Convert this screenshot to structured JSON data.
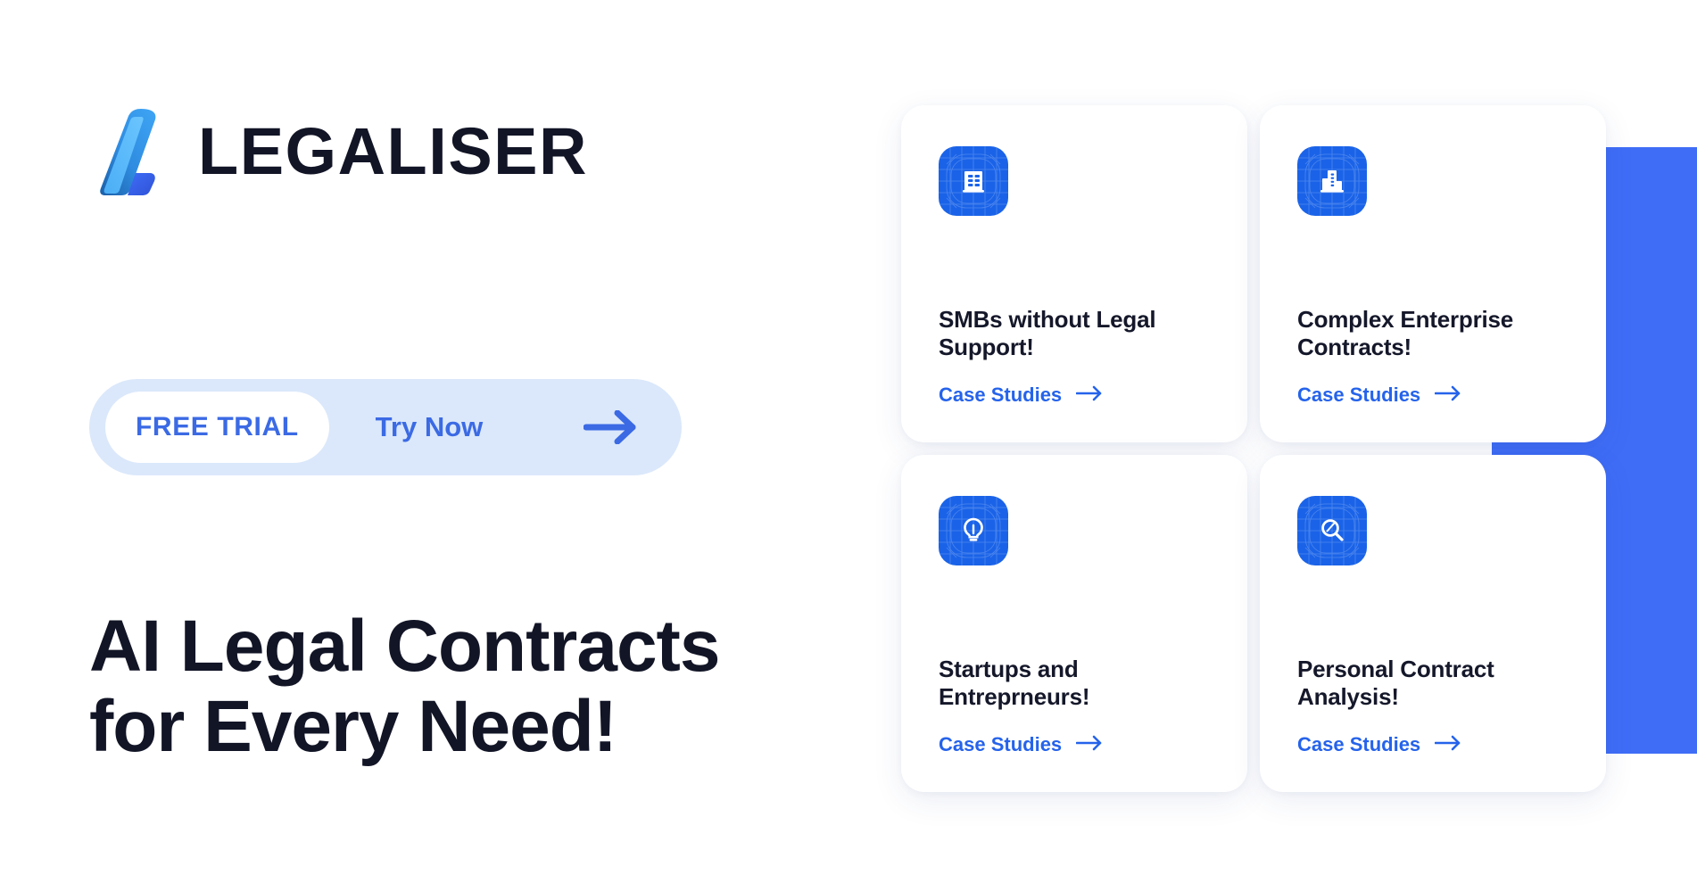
{
  "brand": {
    "name": "LEGALISER",
    "logo_icon": "legaliser-swoosh-logo",
    "colors": {
      "ink": "#121526",
      "accent_blue": "#2563eb",
      "royal_blue": "#3f6df6",
      "icon_tile_blue": "#1a63e8",
      "pill_background": "#dbe8fb",
      "card_background": "#ffffff",
      "page_background": "#ffffff"
    }
  },
  "hero": {
    "headline_line1": "AI Legal Contracts",
    "headline_line2": "for Every Need!",
    "trial": {
      "badge_label": "FREE TRIAL",
      "cta_label": "Try Now",
      "arrow_icon": "arrow-right-icon"
    }
  },
  "cards": [
    {
      "icon": "apartment-building-icon",
      "title": "SMBs without Legal Support!",
      "link_label": "Case Studies",
      "link_arrow_icon": "arrow-right-icon"
    },
    {
      "icon": "enterprise-skyscraper-icon",
      "title": "Complex Enterprise Contracts!",
      "link_label": "Case Studies",
      "link_arrow_icon": "arrow-right-icon"
    },
    {
      "icon": "lightbulb-icon",
      "title": "Startups and Entreprneurs!",
      "link_label": "Case Studies",
      "link_arrow_icon": "arrow-right-icon"
    },
    {
      "icon": "magnifying-glass-icon",
      "title": "Personal Contract Analysis!",
      "link_label": "Case Studies",
      "link_arrow_icon": "arrow-right-icon"
    }
  ],
  "decoration": {
    "shape": "blue-arrow-hexagon"
  }
}
